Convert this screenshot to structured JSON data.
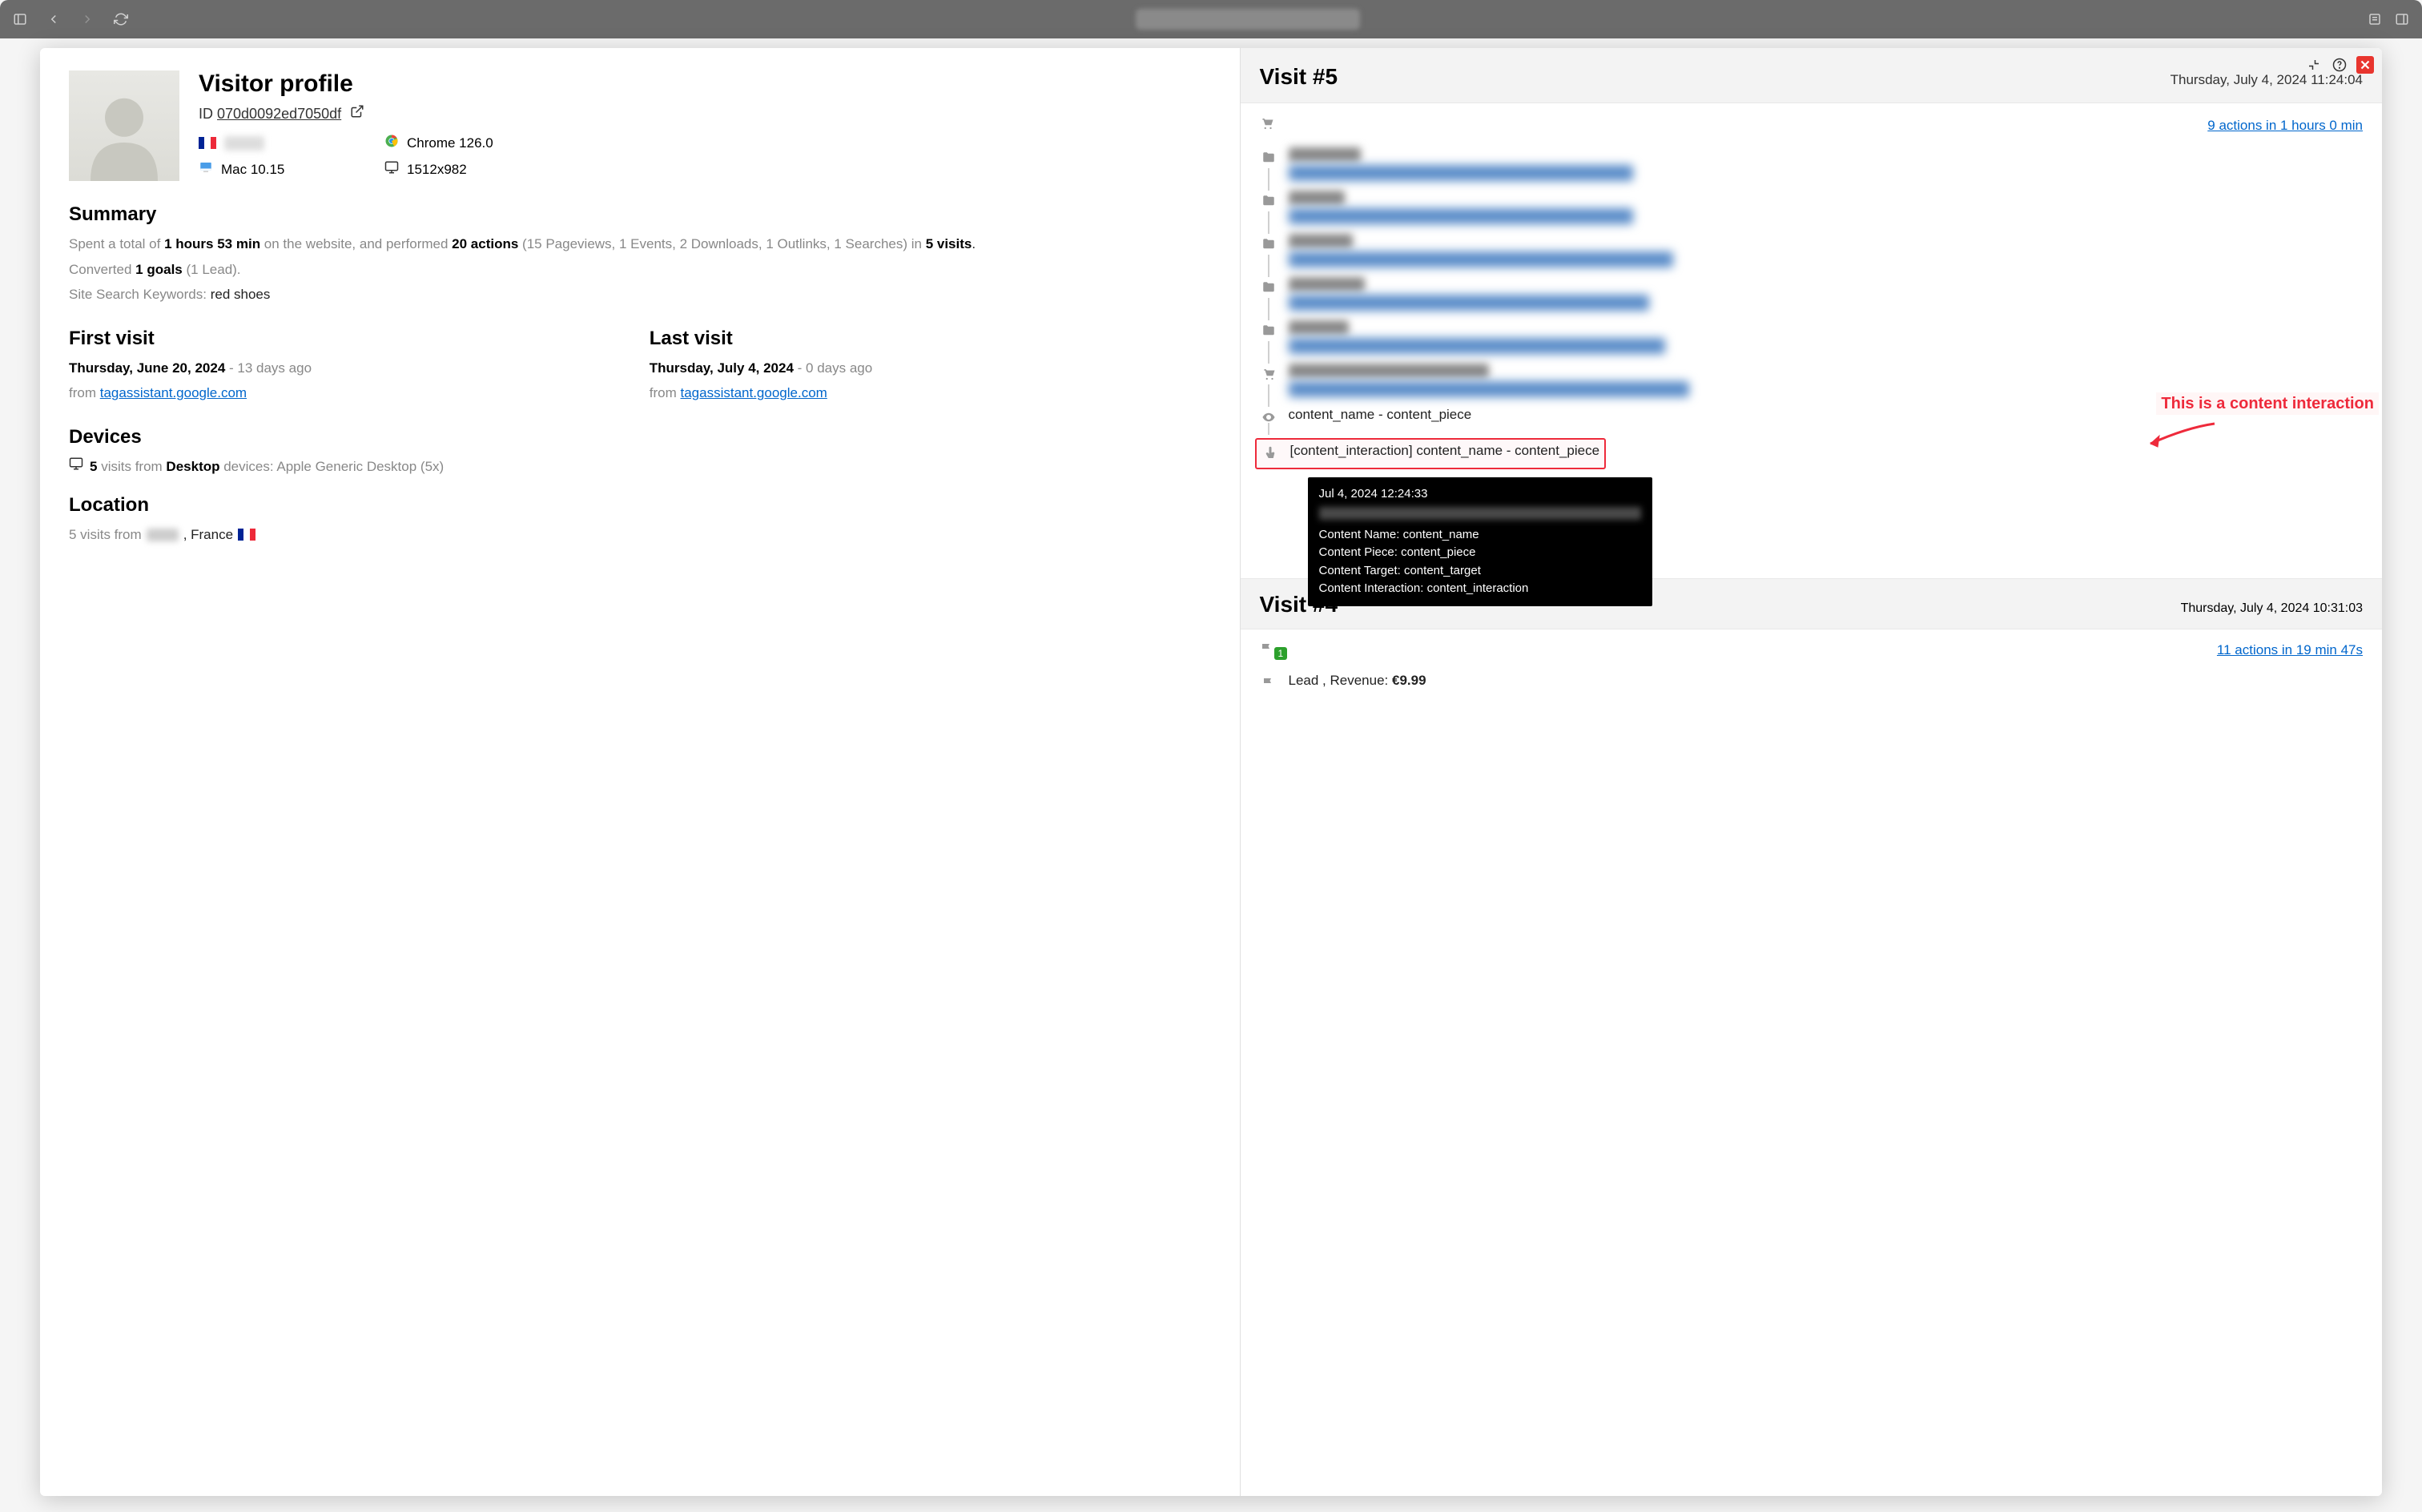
{
  "profile": {
    "title": "Visitor profile",
    "id_label": "ID",
    "id_value": "070d0092ed7050df",
    "browser": "Chrome 126.0",
    "os": "Mac 10.15",
    "resolution": "1512x982"
  },
  "summary": {
    "heading": "Summary",
    "time_prefix": "Spent a total of ",
    "time_value": "1 hours 53 min",
    "time_suffix": " on the website, and performed ",
    "actions_value": "20 actions",
    "actions_breakdown": " (15 Pageviews, 1 Events, 2 Downloads, 1 Outlinks, 1 Searches) in ",
    "visits_value": "5 visits",
    "converted_prefix": "Converted ",
    "converted_goals": "1 goals",
    "converted_suffix": " (1 Lead).",
    "keywords_label": "Site Search Keywords: ",
    "keywords_value": "red shoes"
  },
  "first_visit": {
    "heading": "First visit",
    "date": "Thursday, June 20, 2024",
    "ago": " - 13 days ago",
    "from_label": "from ",
    "referrer": "tagassistant.google.com"
  },
  "last_visit": {
    "heading": "Last visit",
    "date": "Thursday, July 4, 2024",
    "ago": " - 0 days ago",
    "from_label": "from ",
    "referrer": "tagassistant.google.com"
  },
  "devices": {
    "heading": "Devices",
    "count": "5",
    "text1": " visits from ",
    "device_type": "Desktop",
    "text2": " devices: Apple Generic Desktop (5x)"
  },
  "location": {
    "heading": "Location",
    "text": "5 visits from ",
    "country": ", France "
  },
  "visit5": {
    "title": "Visit #5",
    "date": "Thursday, July 4, 2024 11:24:04",
    "actions_link": "9 actions in 1 hours 0 min",
    "content_view": "content_name - content_piece",
    "content_interaction": "[content_interaction] content_name - content_piece"
  },
  "annotation": {
    "text": "This is a content interaction"
  },
  "tooltip": {
    "timestamp": "Jul 4, 2024 12:24:33",
    "name_label": "Content Name: ",
    "name_val": "content_name",
    "piece_label": "Content Piece: ",
    "piece_val": "content_piece",
    "target_label": "Content Target: ",
    "target_val": "content_target",
    "interaction_label": "Content Interaction: ",
    "interaction_val": "content_interaction"
  },
  "visit4": {
    "title": "Visit #4",
    "date": "Thursday, July 4, 2024 10:31:03",
    "actions_link": "11 actions in 19 min 47s",
    "goal_text": "Lead , Revenue: ",
    "goal_amount": "€9.99"
  }
}
